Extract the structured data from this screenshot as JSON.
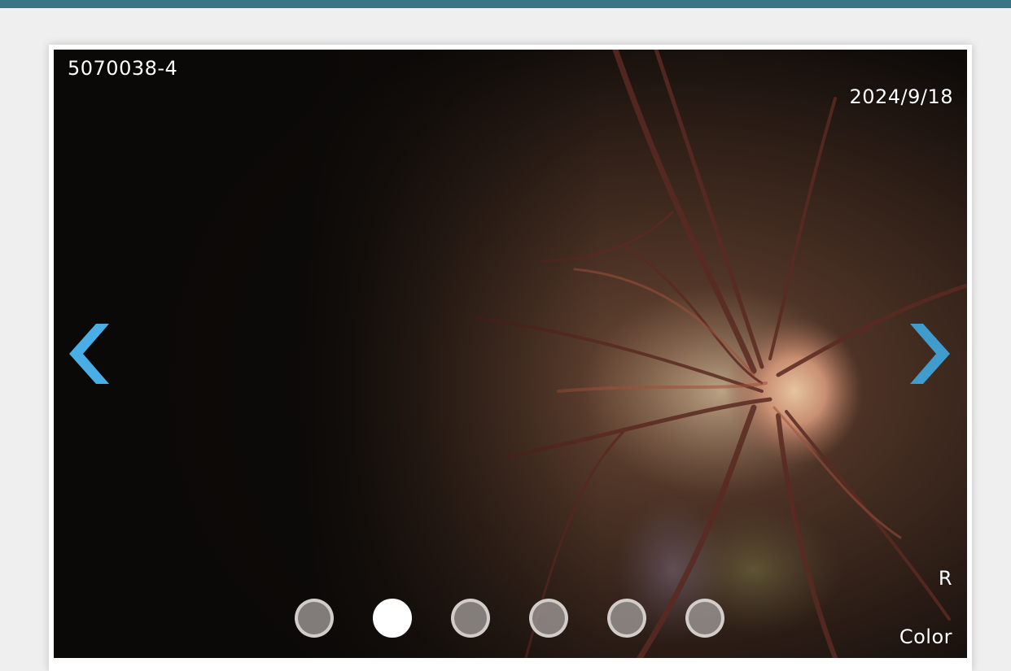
{
  "viewer": {
    "patient_id": "5070038-4",
    "exam_date": "2024/9/18",
    "eye_side": "R",
    "modality": "Color",
    "prev_icon": "chevron-left-icon",
    "next_icon": "chevron-right-icon",
    "image_description_icon": "fundus-photo",
    "slides_total": 6,
    "active_slide": 2
  },
  "colors": {
    "top_bar": "#3a7585",
    "arrow_prev": "#4aaee6",
    "arrow_next": "#3f9ccc",
    "page_background": "#efefef"
  }
}
